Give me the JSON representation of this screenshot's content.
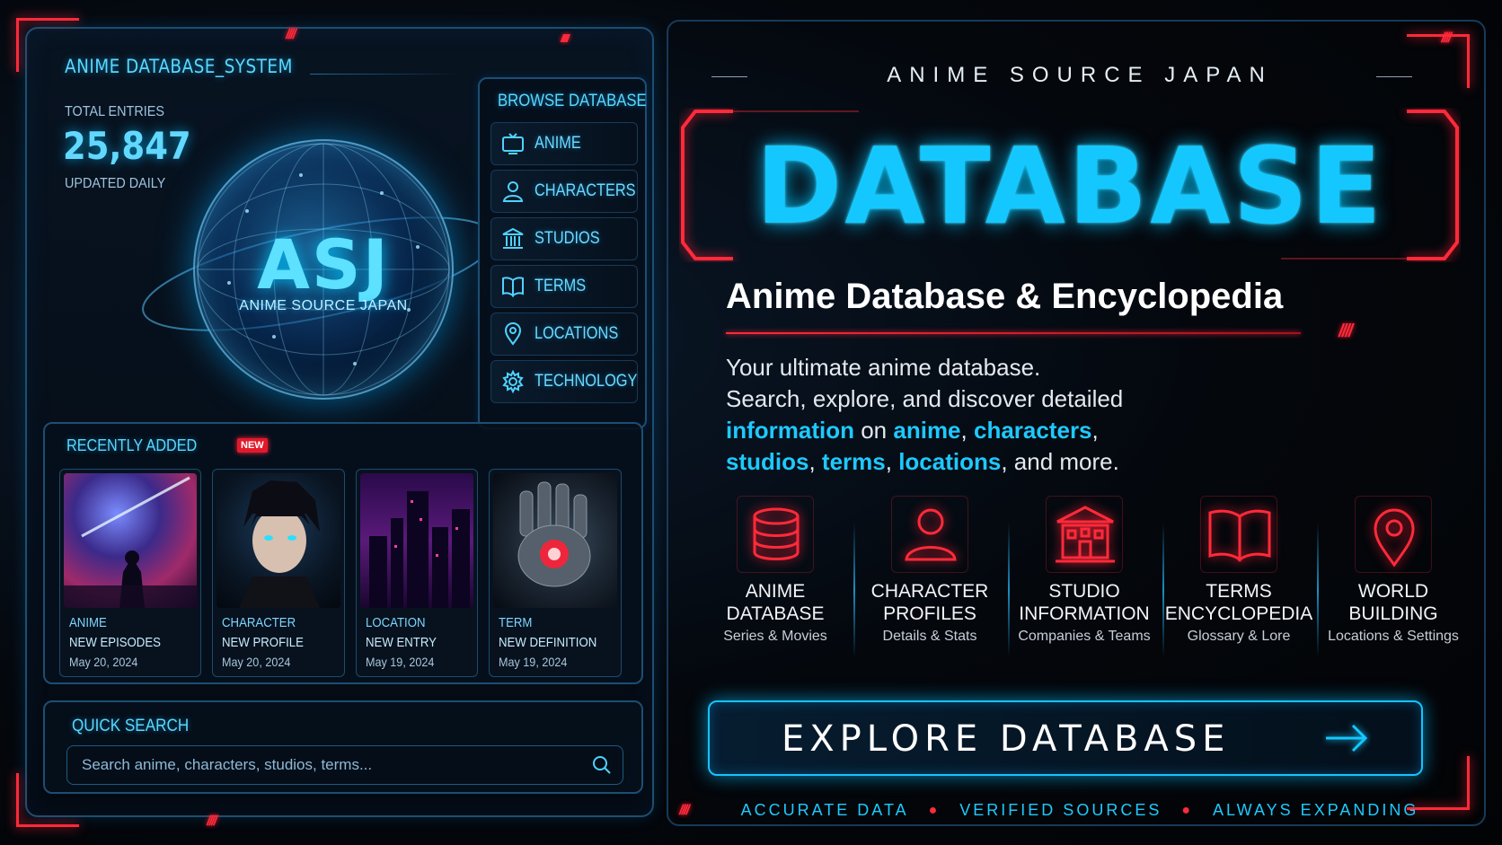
{
  "left": {
    "system_title": "ANIME DATABASE_SYSTEM",
    "stats": {
      "label": "TOTAL ENTRIES",
      "value": "25,847",
      "sub": "UPDATED DAILY"
    },
    "logo": {
      "mark": "ASJ",
      "name": "ANIME SOURCE JAPAN"
    },
    "browse": {
      "title": "BROWSE DATABASE",
      "items": [
        {
          "label": "ANIME",
          "icon": "tv-icon"
        },
        {
          "label": "CHARACTERS",
          "icon": "user-icon"
        },
        {
          "label": "STUDIOS",
          "icon": "building-icon"
        },
        {
          "label": "TERMS",
          "icon": "book-icon"
        },
        {
          "label": "LOCATIONS",
          "icon": "map-pin-icon"
        },
        {
          "label": "TECHNOLOGY",
          "icon": "gear-icon"
        }
      ]
    },
    "recent": {
      "title": "RECENTLY ADDED",
      "badge": "NEW",
      "cards": [
        {
          "category": "ANIME",
          "name": "NEW EPISODES",
          "date": "May 20, 2024"
        },
        {
          "category": "CHARACTER",
          "name": "NEW PROFILE",
          "date": "May 20, 2024"
        },
        {
          "category": "LOCATION",
          "name": "NEW ENTRY",
          "date": "May 19, 2024"
        },
        {
          "category": "TERM",
          "name": "NEW DEFINITION",
          "date": "May 19, 2024"
        }
      ]
    },
    "search": {
      "title": "QUICK SEARCH",
      "placeholder": "Search anime, characters, studios, terms..."
    }
  },
  "right": {
    "brand": "ANIME SOURCE JAPAN",
    "headline": "DATABASE",
    "subtitle": "Anime Database & Encyclopedia",
    "description": {
      "line1": "Your ultimate anime database.",
      "line2": "Search, explore, and discover detailed",
      "w_information": "information",
      "w_on": " on ",
      "w_anime": "anime",
      "w_comma1": ", ",
      "w_characters": "characters",
      "w_comma2": ",",
      "w_studios": "studios",
      "w_comma3": ", ",
      "w_terms": "terms",
      "w_comma4": ", ",
      "w_locations": "locations",
      "w_tail": ", and more."
    },
    "features": [
      {
        "line1": "ANIME",
        "line2": "DATABASE",
        "sub": "Series & Movies",
        "icon": "database-icon"
      },
      {
        "line1": "CHARACTER",
        "line2": "PROFILES",
        "sub": "Details & Stats",
        "icon": "person-icon"
      },
      {
        "line1": "STUDIO",
        "line2": "INFORMATION",
        "sub": "Companies & Teams",
        "icon": "studio-building-icon"
      },
      {
        "line1": "TERMS",
        "line2": "ENCYCLOPEDIA",
        "sub": "Glossary & Lore",
        "icon": "open-book-icon"
      },
      {
        "line1": "WORLD",
        "line2": "BUILDING",
        "sub": "Locations & Settings",
        "icon": "location-pin-icon"
      }
    ],
    "cta": "EXPLORE DATABASE",
    "tags": [
      "ACCURATE DATA",
      "VERIFIED SOURCES",
      "ALWAYS EXPANDING"
    ]
  },
  "colors": {
    "cyan": "#14c8ff",
    "red": "#ff2a3a",
    "panel_border": "#1d4e72"
  }
}
